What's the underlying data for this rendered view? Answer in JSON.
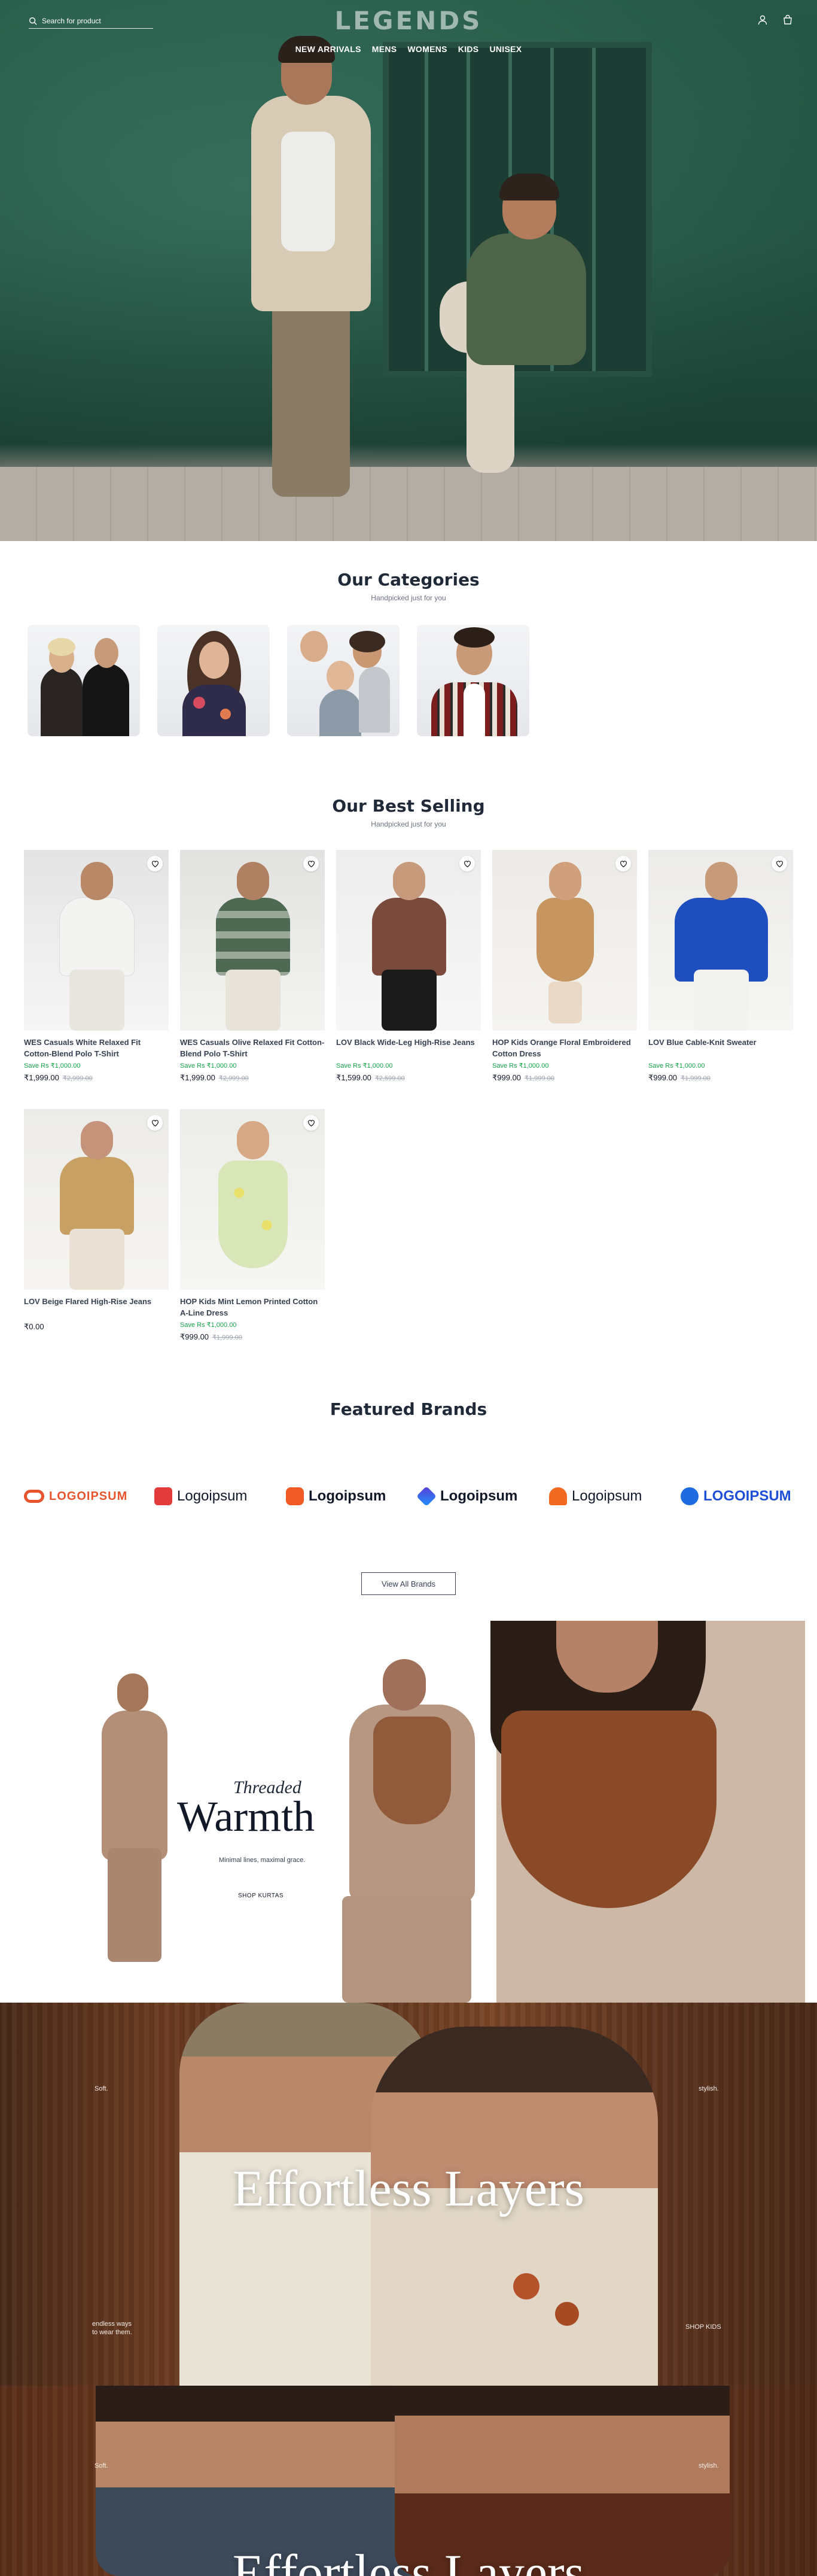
{
  "header": {
    "search_placeholder": "Search for product",
    "logo": "LEGENDS",
    "nav": [
      "NEW ARRIVALS",
      "MENS",
      "WOMENS",
      "KIDS",
      "UNISEX"
    ]
  },
  "categories": {
    "title": "Our Categories",
    "subtitle": "Handpicked just for you"
  },
  "best_selling": {
    "title": "Our Best Selling",
    "subtitle": "Handpicked just for you",
    "products": [
      {
        "name": "WES Casuals White Relaxed Fit Cotton-Blend Polo T-Shirt",
        "save": "Save Rs ₹1,000.00",
        "price": "₹1,999.00",
        "mrp": "₹2,999.00"
      },
      {
        "name": "WES Casuals Olive Relaxed Fit Cotton-Blend Polo T-Shirt",
        "save": "Save Rs ₹1,000.00",
        "price": "₹1,999.00",
        "mrp": "₹2,999.00"
      },
      {
        "name": "LOV Black Wide-Leg High-Rise Jeans",
        "save": "Save Rs ₹1,000.00",
        "price": "₹1,599.00",
        "mrp": "₹2,599.00"
      },
      {
        "name": "HOP Kids Orange Floral Embroidered Cotton Dress",
        "save": "Save Rs ₹1,000.00",
        "price": "₹999.00",
        "mrp": "₹1,999.00"
      },
      {
        "name": "LOV Blue Cable-Knit Sweater",
        "save": "Save Rs ₹1,000.00",
        "price": "₹999.00",
        "mrp": "₹1,999.00"
      },
      {
        "name": "LOV Beige Flared High-Rise Jeans",
        "save": "",
        "price": "₹0.00",
        "mrp": ""
      },
      {
        "name": "HOP Kids Mint Lemon Printed Cotton A-Line Dress",
        "save": "Save Rs ₹1,000.00",
        "price": "₹999.00",
        "mrp": "₹1,999.00"
      }
    ]
  },
  "brands": {
    "title": "Featured Brands",
    "items": [
      "LOGOIPSUM",
      "Logoipsum",
      "Logoipsum",
      "Logoipsum",
      "Logoipsum",
      "LOGOIPSUM"
    ],
    "view_all": "View All Brands"
  },
  "warmth_banner": {
    "title_small": "Threaded",
    "title": "Warmth",
    "tagline": "Minimal lines, maximal grace.",
    "cta": "SHOP KURTAS"
  },
  "layers_banner": {
    "title": "Effortless Layers",
    "left_top": "Soft.",
    "right_top": "stylish.",
    "left_bottom": "endless ways\nto wear them.",
    "cta": "SHOP KIDS"
  },
  "layers_banner_2": {
    "title": "Effortless Layers",
    "left_top": "Soft.",
    "right_top": "stylish."
  },
  "colors": {
    "save_green": "#16a34a",
    "hero_wall": "#2d6b55",
    "wood": "#6b3b20"
  }
}
